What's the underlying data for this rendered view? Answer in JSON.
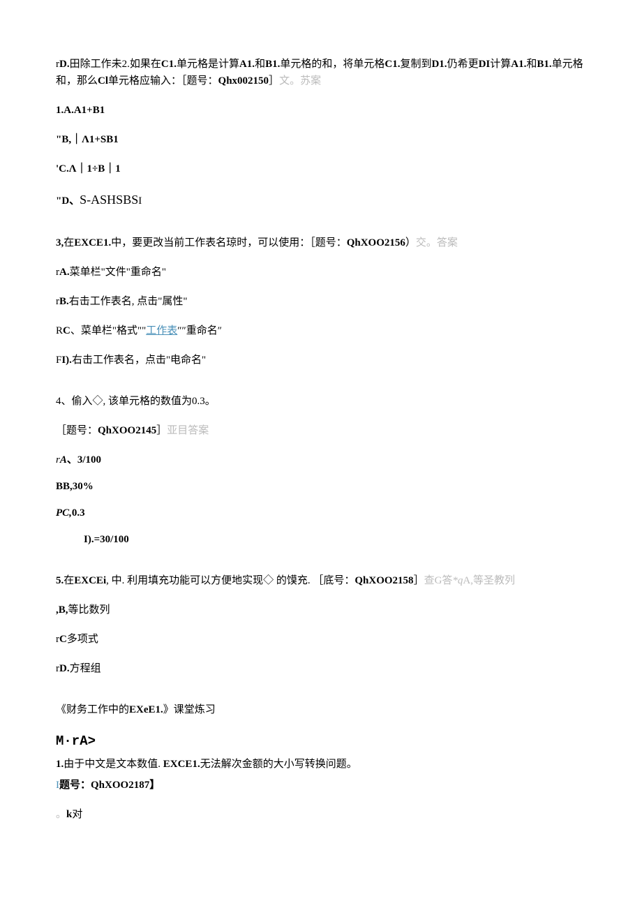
{
  "q2": {
    "pre": "r",
    "d_label": "D.",
    "stem_part1": "田除工作未2.如果在",
    "c1": "C1.",
    "stem_part2": "单元格是计算",
    "a1": "A1.",
    "and1": "和",
    "b1": "B1.",
    "stem_part3": "单元格的和，将单元格",
    "c1_2": "C1.",
    "stem_part4": "复制到",
    "d1": "D1.",
    "stem_part5": "仍希更",
    "di": "DI",
    "stem_part6": "计算",
    "a1_2": "A1.",
    "and2": "和",
    "b1_2": "B1.",
    "stem_part7": "单元格和，那么",
    "cl": "Cl",
    "stem_part8": "单元格应输入：［题号：",
    "qnum": "Qhx002150",
    "bracket": "］",
    "suffix": "文。苏案",
    "optA": "1.A.A1+B1",
    "optB": "\"B,｜Λ1+SB1",
    "optC": "'C.Λ｜1÷B｜1",
    "optD_pre": "\"D、",
    "optD": "S-ASHSBS",
    "optD_suf": "I"
  },
  "q3": {
    "stem_pre": "3,",
    "stem_part1": "在",
    "excel": "EXCE1.",
    "stem_part2": "中，要更改当前工作表名琼时，可以使用：［题号：",
    "qnum": "QhXOO2156",
    "bracket": "）",
    "suffix": "交。答案",
    "optA_pre": "r",
    "optA_label": "A.",
    "optA": "菜单栏\"文件\"重命名\"",
    "optB_pre": "r",
    "optB_label": "B.",
    "optB": "右击工作表名, 点击\"属性\"",
    "optC_pre": "R",
    "optC_label": "C",
    "optC": "、菜单栏\"格式\"\"",
    "optC_link": "工作表",
    "optC_suf": "″″重命名″",
    "optD_pre": "F",
    "optD_label": "I).",
    "optD": "右击工作表名，点击\"电命名\""
  },
  "q4": {
    "stem": "4、偷入◇, 该单元格的数值为0.3。",
    "qnum_pre": "［题号：",
    "qnum": "QhXOO2145",
    "bracket": "］",
    "suffix": "亚目答案",
    "optA_pre": "r",
    "optA_label": "A",
    "optA": "、3/100",
    "optB": "BB,30%",
    "optC_label": "PC,",
    "optC": "0.3",
    "optD_pre": "I",
    "optD": ").=30/100"
  },
  "q5": {
    "stem_pre": "5.",
    "stem_part1": "在",
    "excel": "EXCEi",
    "stem_part2": ", 中. 利用填充功能可以方便地实现◇ 的馍充. ［底号：",
    "qnum": "QhXOO2158",
    "bracket": "］",
    "suffix_part1": "查G答",
    "suffix_q": "*q",
    "suffix_part2": "A,等圣教列",
    "optB_pre": ",",
    "optB_label": "B,",
    "optB": "等比数列",
    "optC_pre": "r",
    "optC_label": "C",
    "optC": "多项式",
    "optD_pre": "r",
    "optD_label": "D.",
    "optD": "方程组"
  },
  "section": {
    "title_pre": "《财务工作中的",
    "title_bold": "EXeE1.",
    "title_suf": "》课堂炼习",
    "header": "M·rA>"
  },
  "q1b": {
    "stem_pre": "1.",
    "stem_part1": "由于中文是文本数值. ",
    "excel": "EXCE1.",
    "stem_part2": "无法解次金额的大小写转换问题。",
    "qnum_pre": "I",
    "qnum_label": "题号：",
    "qnum": "QhXOO2187",
    "bracket": "】",
    "opt_pre": "。",
    "opt_label": "k",
    "opt": "对"
  }
}
